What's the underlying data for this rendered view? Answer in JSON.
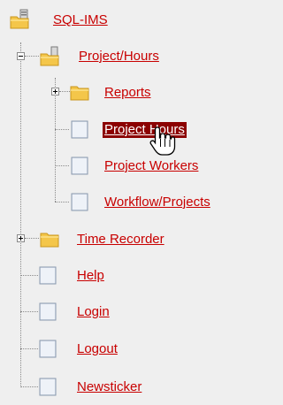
{
  "tree": {
    "root": {
      "label": "SQL-IMS"
    },
    "project_hours": {
      "label": "Project/Hours",
      "children": {
        "reports": "Reports",
        "project_hours": "Project Hours",
        "project_workers": "Project Workers",
        "workflow_projects": "Workflow/Projects"
      }
    },
    "time_recorder": "Time Recorder",
    "help": "Help",
    "login": "Login",
    "logout": "Logout",
    "newsticker": "Newsticker"
  },
  "colors": {
    "link": "#c80000",
    "selected_bg": "#8b0000",
    "selected_text": "#ffffff",
    "background": "#efefef",
    "folder": "#f4c64a"
  },
  "icons": {
    "root": "server-folder-icon",
    "folder": "folder-icon",
    "page": "document-icon",
    "cursor": "hand-pointer-cursor-icon"
  }
}
